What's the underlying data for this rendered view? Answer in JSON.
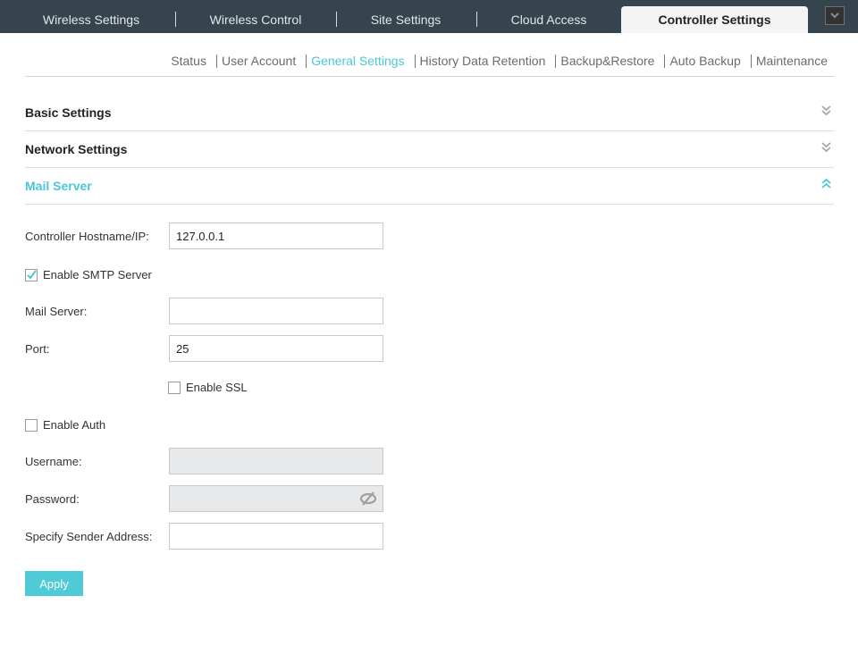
{
  "top_tabs": [
    {
      "label": "Wireless Settings",
      "active": false
    },
    {
      "label": "Wireless Control",
      "active": false
    },
    {
      "label": "Site Settings",
      "active": false
    },
    {
      "label": "Cloud Access",
      "active": false
    },
    {
      "label": "Controller Settings",
      "active": true
    }
  ],
  "top_menu_icon": "chevron-down-icon",
  "subnav": [
    {
      "label": "Status",
      "active": false
    },
    {
      "label": "User Account",
      "active": false
    },
    {
      "label": "General Settings",
      "active": true
    },
    {
      "label": "History Data Retention",
      "active": false
    },
    {
      "label": "Backup&Restore",
      "active": false
    },
    {
      "label": "Auto Backup",
      "active": false
    },
    {
      "label": "Maintenance",
      "active": false
    }
  ],
  "sections": [
    {
      "title": "Basic Settings",
      "expanded": false,
      "icon": "double-chevron-down-icon"
    },
    {
      "title": "Network Settings",
      "expanded": false,
      "icon": "double-chevron-down-icon"
    },
    {
      "title": "Mail Server",
      "expanded": true,
      "icon": "double-chevron-up-icon"
    }
  ],
  "mail_server": {
    "hostname_label": "Controller Hostname/IP:",
    "hostname_value": "127.0.0.1",
    "enable_smtp_label": "Enable SMTP Server",
    "enable_smtp_checked": true,
    "mail_server_label": "Mail Server:",
    "mail_server_value": "",
    "port_label": "Port:",
    "port_value": "25",
    "enable_ssl_label": "Enable SSL",
    "enable_ssl_checked": false,
    "enable_auth_label": "Enable Auth",
    "enable_auth_checked": false,
    "username_label": "Username:",
    "username_value": "",
    "password_label": "Password:",
    "password_value": "",
    "password_icon": "eye-slash-icon",
    "sender_label": "Specify Sender Address:",
    "sender_value": "",
    "apply_label": "Apply"
  },
  "colors": {
    "accent": "#4ac8d5",
    "topbar": "#36444d",
    "apply_button": "#4ecbd6"
  }
}
